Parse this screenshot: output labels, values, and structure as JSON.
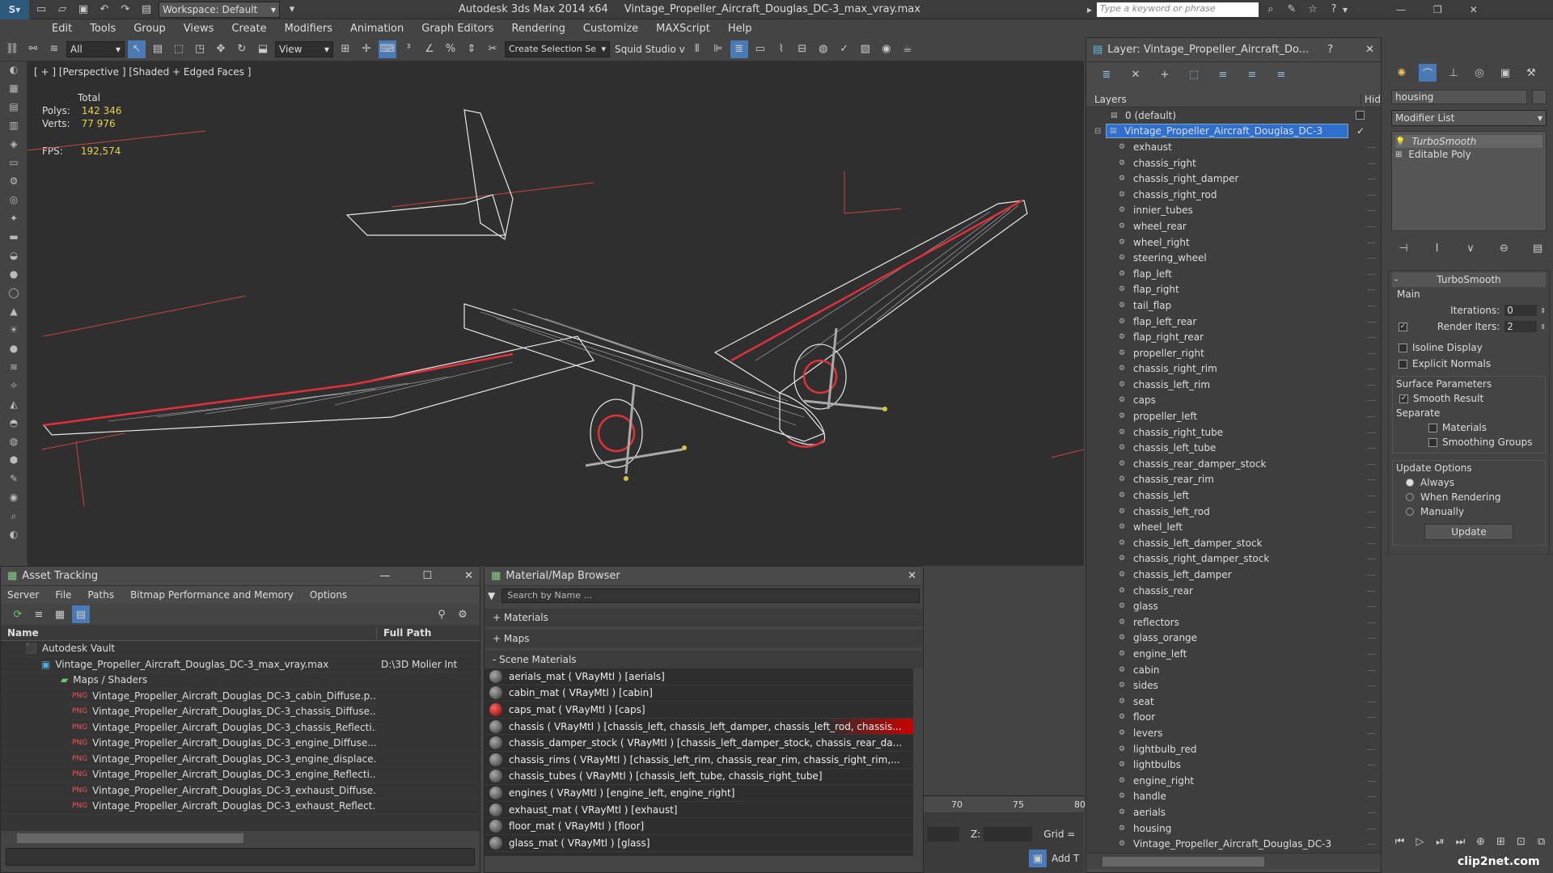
{
  "app": {
    "title": "Autodesk 3ds Max  2014 x64",
    "file": "Vintage_Propeller_Aircraft_Douglas_DC-3_max_vray.max",
    "workspace": "Workspace: Default",
    "search_placeholder": "Type a keyword or phrase"
  },
  "menu": [
    "Edit",
    "Tools",
    "Group",
    "Views",
    "Create",
    "Modifiers",
    "Animation",
    "Graph Editors",
    "Rendering",
    "Customize",
    "MAXScript",
    "Help"
  ],
  "toolbar": {
    "filter": "All",
    "refcoord": "View",
    "selection_set": "Create Selection Se",
    "studio": "Squid Studio v"
  },
  "viewport": {
    "label": "[ + ] [Perspective ] [Shaded + Edged Faces ]",
    "total_label": "Total",
    "polys_label": "Polys:",
    "polys": "142 346",
    "verts_label": "Verts:",
    "verts": "77 976",
    "fps_label": "FPS:",
    "fps": "192,574"
  },
  "asset": {
    "title": "Asset Tracking",
    "menu": [
      "Server",
      "File",
      "Paths",
      "Bitmap Performance and Memory",
      "Options"
    ],
    "col_name": "Name",
    "col_path": "Full Path",
    "vault": "Autodesk Vault",
    "file": "Vintage_Propeller_Aircraft_Douglas_DC-3_max_vray.max",
    "file_path": "D:\\3D Molier Int",
    "maps": "Maps / Shaders",
    "items": [
      "Vintage_Propeller_Aircraft_Douglas_DC-3_cabin_Diffuse.p...",
      "Vintage_Propeller_Aircraft_Douglas_DC-3_chassis_Diffuse....",
      "Vintage_Propeller_Aircraft_Douglas_DC-3_chassis_Reflecti...",
      "Vintage_Propeller_Aircraft_Douglas_DC-3_engine_Diffuse....",
      "Vintage_Propeller_Aircraft_Douglas_DC-3_engine_displace...",
      "Vintage_Propeller_Aircraft_Douglas_DC-3_engine_Reflecti...",
      "Vintage_Propeller_Aircraft_Douglas_DC-3_exhaust_Diffuse...",
      "Vintage_Propeller_Aircraft_Douglas_DC-3_exhaust_Reflect..."
    ]
  },
  "matbrowser": {
    "title": "Material/Map Browser",
    "search_placeholder": "Search by Name ...",
    "materials": "+ Materials",
    "maps": "+ Maps",
    "scene": "- Scene Materials",
    "items": [
      "aerials_mat  ( VRayMtl ) [aerials]",
      "cabin_mat  ( VRayMtl ) [cabin]",
      "caps_mat  ( VRayMtl ) [caps]",
      "chassis ( VRayMtl ) [chassis_left, chassis_left_damper, chassis_left_rod, chassis...",
      "chassis_damper_stock ( VRayMtl ) [chassis_left_damper_stock, chassis_rear_da...",
      "chassis_rims ( VRayMtl ) [chassis_left_rim, chassis_rear_rim, chassis_right_rim,...",
      "chassis_tubes ( VRayMtl ) [chassis_left_tube, chassis_right_tube]",
      "engines  ( VRayMtl ) [engine_left, engine_right]",
      "exhaust_mat  ( VRayMtl ) [exhaust]",
      "floor_mat  ( VRayMtl ) [floor]",
      "glass_mat  ( VRayMtl ) [glass]"
    ]
  },
  "layer": {
    "title": "Layer: Vintage_Propeller_Aircraft_Do...",
    "col_layers": "Layers",
    "col_hide": "Hid",
    "default": "0 (default)",
    "root": "Vintage_Propeller_Aircraft_Douglas_DC-3",
    "items": [
      "exhaust",
      "chassis_right",
      "chassis_right_damper",
      "chassis_right_rod",
      "innier_tubes",
      "wheel_rear",
      "wheel_right",
      "steering_wheel",
      "flap_left",
      "flap_right",
      "tail_flap",
      "flap_left_rear",
      "flap_right_rear",
      "propeller_right",
      "chassis_right_rim",
      "chassis_left_rim",
      "caps",
      "propeller_left",
      "chassis_right_tube",
      "chassis_left_tube",
      "chassis_rear_damper_stock",
      "chassis_rear_rim",
      "chassis_left",
      "chassis_left_rod",
      "wheel_left",
      "chassis_left_damper_stock",
      "chassis_right_damper_stock",
      "chassis_left_damper",
      "chassis_rear",
      "glass",
      "reflectors",
      "glass_orange",
      "engine_left",
      "cabin",
      "sides",
      "seat",
      "floor",
      "levers",
      "lightbulb_red",
      "lightbulbs",
      "engine_right",
      "handle",
      "aerials",
      "housing",
      "Vintage_Propeller_Aircraft_Douglas_DC-3"
    ]
  },
  "cmd": {
    "object_name": "housing",
    "modifier_list": "Modifier List",
    "stack": [
      "TurboSmooth",
      "Editable Poly"
    ],
    "rollout": "TurboSmooth",
    "main": "Main",
    "iterations_label": "Iterations:",
    "iterations": "0",
    "render_iters_label": "Render Iters:",
    "render_iters": "2",
    "isoline": "Isoline Display",
    "explicit": "Explicit Normals",
    "surface": "Surface Parameters",
    "smooth": "Smooth Result",
    "separate": "Separate",
    "materials": "Materials",
    "smoothing": "Smoothing Groups",
    "update_options": "Update Options",
    "always": "Always",
    "when_rendering": "When Rendering",
    "manually": "Manually",
    "update": "Update"
  },
  "timeline": {
    "t70": "70",
    "t75": "75",
    "t80": "80",
    "z_label": "Z:",
    "grid": "Grid =",
    "addt": "Add T"
  },
  "watermark": "clip2net.com",
  "colors": {
    "accent": "#3a7ad5",
    "wire": "#ffffff",
    "red": "#e0303a"
  }
}
